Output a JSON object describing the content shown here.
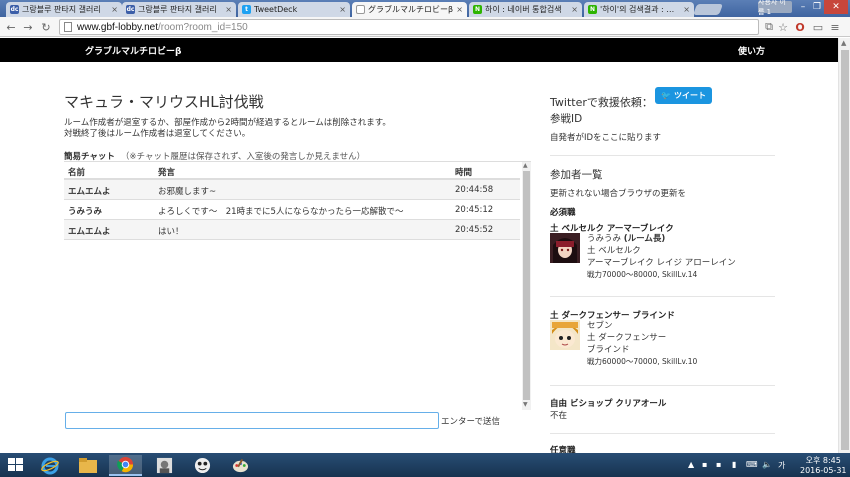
{
  "browser": {
    "tabs": [
      {
        "title": "그랑블루 판타지 갤러리",
        "favicon": "dc-icon",
        "active": false
      },
      {
        "title": "그랑블루 판타지 갤러리",
        "favicon": "dc-icon",
        "active": false
      },
      {
        "title": "TweetDeck",
        "favicon": "twitter-icon",
        "active": false
      },
      {
        "title": "グラブルマルチロビーβ",
        "favicon": "page-icon",
        "active": true
      },
      {
        "title": "하이 : 네이버 통합검색",
        "favicon": "naver-icon",
        "active": false
      },
      {
        "title": "'하이'의 검색결과 : 네이",
        "favicon": "naver-icon",
        "active": false
      }
    ],
    "profile_label": "사용자 이름 1",
    "url_host": "www.gbf-lobby.net",
    "url_path": "/room?room_id=150"
  },
  "navbar": {
    "brand": "グラブルマルチロビーβ",
    "howto": "使い方"
  },
  "room": {
    "title": "マキュラ・マリウスHL討伐戦",
    "notice1": "ルーム作成者が退室するか、部屋作成から2時間が経過するとルームは削除されます。",
    "notice2": "対戦終了後はルーム作成者は退室してください。"
  },
  "chat": {
    "label": "簡易チャット",
    "sublabel": "（※チャット履歴は保存されず、入室後の発言しか見えません）",
    "columns": [
      "名前",
      "発言",
      "時間"
    ],
    "rows": [
      {
        "name": "エムエムよ",
        "message": "お邪魔します~",
        "time": "20:44:58"
      },
      {
        "name": "うみうみ",
        "message": "よろしくです〜　21時までに5人にならなかったら一応解散で〜",
        "time": "20:45:12"
      },
      {
        "name": "エムエムよ",
        "message": "はい！",
        "time": "20:45:52"
      }
    ],
    "input_value": "",
    "send_hint": "エンターで送信"
  },
  "sidebar": {
    "twitter_label": "Twitterで救援依頼：",
    "tweet_button": "ツイート",
    "battle_id_label": "参戦ID",
    "battle_id_hint": "自発者がIDをここに貼ります",
    "participants_title": "参加者一覧",
    "refresh_hint": "更新されない場合ブラウザの更新を",
    "required_label": "必須職",
    "slots": [
      {
        "role": "土 ベルセルク アーマーブレイク",
        "player": "うみうみ",
        "player_tag": "(ルーム長)",
        "element_job": "土 ベルセルク",
        "skills": "アーマーブレイク レイジ アローレイン",
        "stats": "戦力70000〜80000, SkillLv.14"
      },
      {
        "role": "土 ダークフェンサー ブラインド",
        "player": "セブン",
        "player_tag": "",
        "element_job": "土 ダークフェンサー",
        "skills": "ブラインド",
        "stats": "戦力60000〜70000, SkillLv.10"
      },
      {
        "role": "自由 ビショップ クリアオール",
        "player": "不在"
      },
      {
        "role": "任意職"
      }
    ]
  },
  "taskbar": {
    "clock_time": "오후 8:45",
    "clock_date": "2016-05-31",
    "ime": "가"
  }
}
